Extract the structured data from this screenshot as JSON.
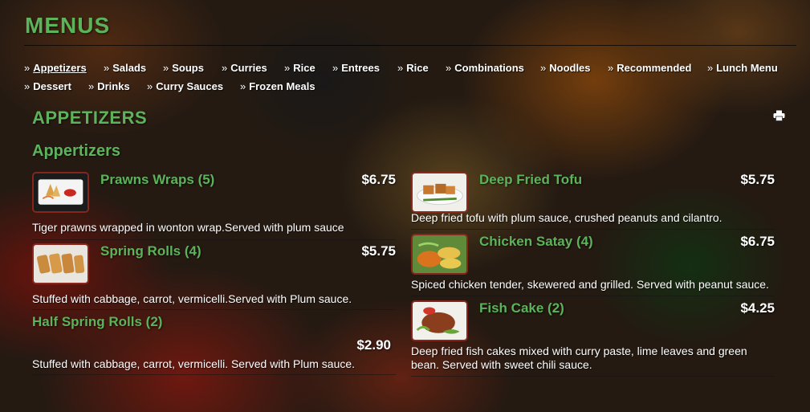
{
  "page": {
    "title": "MENUS",
    "section_title": "APPETIZERS",
    "subsection_title": "Appertizers"
  },
  "nav": {
    "row1": [
      {
        "label": "Appetizers",
        "active": true
      },
      {
        "label": "Salads"
      },
      {
        "label": "Soups"
      },
      {
        "label": "Curries"
      },
      {
        "label": "Rice"
      },
      {
        "label": "Entrees"
      },
      {
        "label": "Rice"
      },
      {
        "label": "Combinations"
      },
      {
        "label": "Noodles"
      },
      {
        "label": "Recommended"
      },
      {
        "label": "Lunch Menu"
      }
    ],
    "row2": [
      {
        "label": "Dessert"
      },
      {
        "label": "Drinks"
      },
      {
        "label": "Curry Sauces"
      },
      {
        "label": "Frozen Meals"
      }
    ],
    "arrow": "»"
  },
  "icons": {
    "print": "print-icon"
  },
  "colors": {
    "accent": "#5cb35a",
    "text": "#ffffff",
    "thumb_border": "#96281e"
  },
  "items": {
    "left": [
      {
        "name": "Prawns Wraps (5)",
        "price": "$6.75",
        "desc": "Tiger prawns wrapped in wonton wrap.Served with plum sauce",
        "image": "prawn-wraps-photo"
      },
      {
        "name": "Spring Rolls (4)",
        "price": "$5.75",
        "desc": "Stuffed with cabbage, carrot, vermicelli.Served with Plum sauce.",
        "image": "spring-rolls-photo"
      },
      {
        "name": "Half Spring Rolls (2)",
        "price": "$2.90",
        "desc": "Stuffed with cabbage, carrot, vermicelli. Served with Plum sauce."
      }
    ],
    "right": [
      {
        "name": "Deep Fried Tofu",
        "price": "$5.75",
        "desc": "Deep fried tofu with plum sauce, crushed peanuts and cilantro.",
        "image": "fried-tofu-photo"
      },
      {
        "name": "Chicken Satay (4)",
        "price": "$6.75",
        "desc": "Spiced chicken tender, skewered and grilled. Served with peanut sauce.",
        "image": "chicken-satay-photo"
      },
      {
        "name": "Fish Cake (2)",
        "price": "$4.25",
        "desc": "Deep fried fish cakes mixed with curry paste, lime leaves and green bean. Served with sweet chili sauce.",
        "image": "fish-cake-photo"
      }
    ]
  }
}
